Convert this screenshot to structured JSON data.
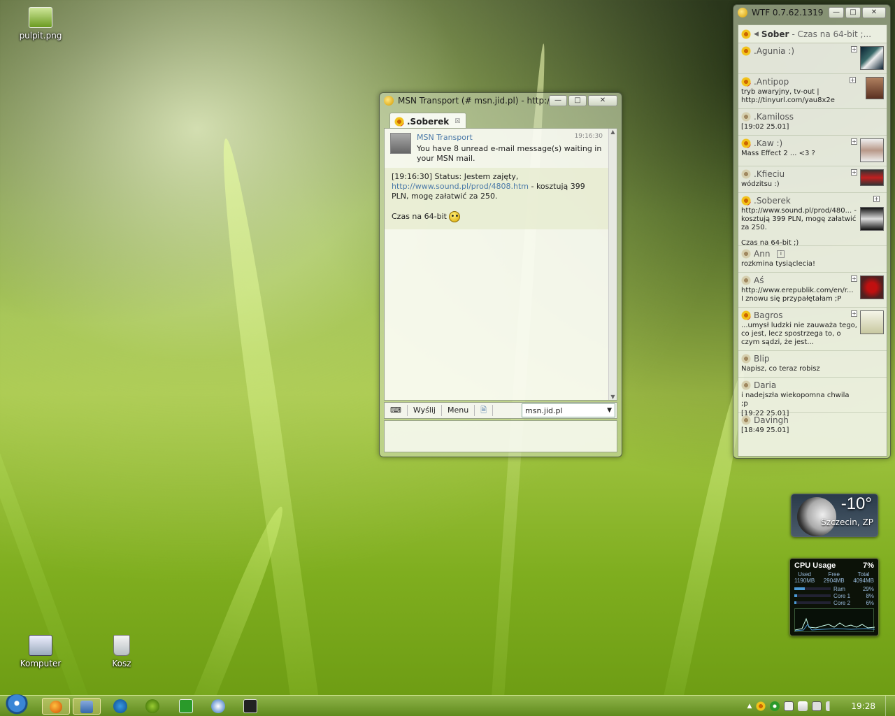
{
  "desktop": {
    "icons": [
      {
        "label": "pulpit.png"
      },
      {
        "label": "Komputer"
      },
      {
        "label": "Kosz"
      }
    ]
  },
  "chat_window": {
    "title": "MSN Transport (# msn.jid.pl) - http://...",
    "tab_label": ".Soberek",
    "message1": {
      "sender": "MSN Transport",
      "time": "19:16:30",
      "text": "You have 8 unread e-mail message(s) waiting in your MSN mail."
    },
    "message2": {
      "prefix": "[19:16:30] Status: Jestem zajęty, ",
      "link": "http://www.sound.pl/prod/4808.htm",
      "suffix": " - kosztują 399 PLN, mogę załatwić za 250.",
      "line2": "Czas na 64-bit"
    },
    "toolbar": {
      "send_label": "Wyślij",
      "menu_label": "Menu",
      "account_value": "msn.jid.pl"
    }
  },
  "roster_window": {
    "title": "WTF 0.7.62.1319",
    "self_nick": "Sober",
    "self_status": "- Czas na 64-bit ;...",
    "contacts": [
      {
        "name": ".Agunia :)",
        "desc": ""
      },
      {
        "name": ".Antipop",
        "desc": "tryb awaryjny, tv-out | http://tinyurl.com/yau8x2e"
      },
      {
        "name": ".Kamiloss",
        "desc": "[19:02 25.01]"
      },
      {
        "name": ".Kaw :)",
        "desc": "Mass Effect 2 ... <3 ?"
      },
      {
        "name": ".Kfieciu",
        "desc": "wódzitsu :)"
      },
      {
        "name": ".Soberek",
        "desc": "http://www.sound.pl/prod/480... - kosztują 399 PLN, mogę załatwić za 250.",
        "desc2": "Czas na 64-bit ;)"
      },
      {
        "name": "Ann",
        "desc": "rozkmina tysiąclecia!"
      },
      {
        "name": "Aś",
        "desc": "http://www.erepublik.com/en/r... I znowu się przypałętałam ;P"
      },
      {
        "name": "Bagros",
        "desc": "...umysł ludzki nie zauważa tego, co jest, lecz spostrzega to, o czym sądzi, że jest..."
      },
      {
        "name": "Blip",
        "desc": "Napisz, co teraz robisz"
      },
      {
        "name": "Daria",
        "desc": "i nadejszła wiekopomna chwila ;p",
        "desc2": "[19:22 25.01]"
      },
      {
        "name": "Davingh",
        "desc": "[18:49 25.01]"
      }
    ]
  },
  "weather": {
    "temp": "-10°",
    "city": "Szczecin, ZP"
  },
  "cpu_gadget": {
    "title": "CPU Usage",
    "percent": "7%",
    "used_label": "Used",
    "used_value": "1190MB",
    "free_label": "Free",
    "free_value": "2904MB",
    "total_label": "Total",
    "total_value": "4094MB",
    "ram_label": "Ram",
    "ram_value": "29%",
    "ram_fraction": 0.29,
    "core1_label": "Core 1",
    "core1_value": "8%",
    "core1_fraction": 0.08,
    "core2_label": "Core 2",
    "core2_value": "6%",
    "core2_fraction": 0.06
  },
  "taskbar": {
    "clock": "19:28"
  }
}
